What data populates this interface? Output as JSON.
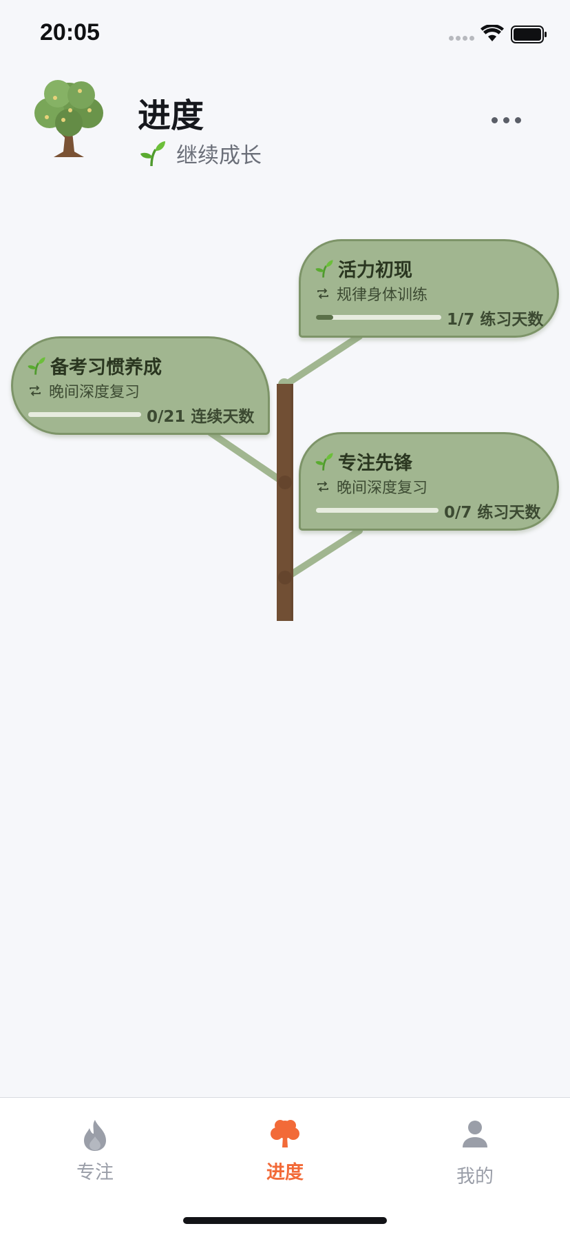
{
  "status_bar": {
    "time": "20:05"
  },
  "header": {
    "title": "进度",
    "subtitle": "继续成长",
    "avatar_icon": "tree-icon",
    "more_icon": "more-horizontal-icon"
  },
  "habits": [
    {
      "title": "活力初现",
      "routine": "规律身体训练",
      "progress_label": "1/7 练习天数",
      "progress": 0.14
    },
    {
      "title": "备考习惯养成",
      "routine": "晚间深度复习",
      "progress_label": "0/21 连续天数",
      "progress": 0
    },
    {
      "title": "专注先锋",
      "routine": "晚间深度复习",
      "progress_label": "0/7 练习天数",
      "progress": 0
    }
  ],
  "tabs": [
    {
      "label": "专注",
      "icon": "flame-icon",
      "active": false
    },
    {
      "label": "进度",
      "icon": "tree-icon",
      "active": true
    },
    {
      "label": "我的",
      "icon": "person-icon",
      "active": false
    }
  ],
  "colors": {
    "accent": "#f26a38",
    "inactive": "#9a9ea8",
    "leaf": "#a1b690",
    "trunk": "#714f34"
  }
}
